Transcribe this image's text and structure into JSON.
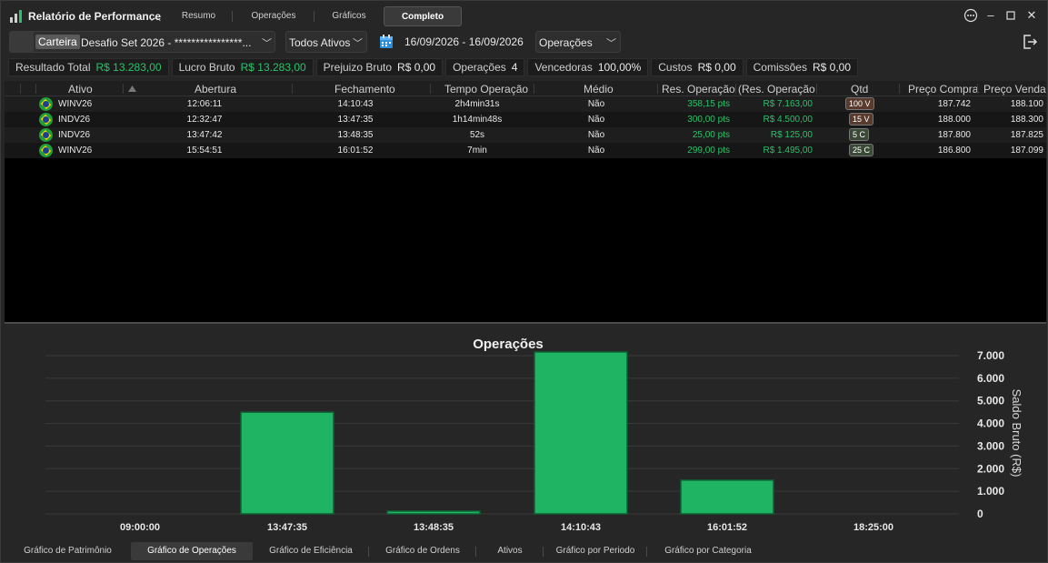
{
  "app": {
    "title": "Relatório de Performance"
  },
  "tabs": [
    {
      "label": "Resumo"
    },
    {
      "label": "Operações"
    },
    {
      "label": "Gráficos"
    },
    {
      "label": "Completo",
      "active": true
    }
  ],
  "filters": {
    "carteira_tag": "Carteira",
    "carteira_value": "Desafio Set 2026 - ****************...",
    "ativos": "Todos Ativos",
    "date_range": "16/09/2026 - 16/09/2026",
    "view": "Operações"
  },
  "stats": [
    {
      "label": "Resultado Total",
      "value": "R$ 13.283,00",
      "green": true
    },
    {
      "label": "Lucro Bruto",
      "value": "R$ 13.283,00",
      "green": true
    },
    {
      "label": "Prejuizo Bruto",
      "value": "R$ 0,00",
      "green": false
    },
    {
      "label": "Operações",
      "value": "4",
      "green": false
    },
    {
      "label": "Vencedoras",
      "value": "100,00%",
      "green": false
    },
    {
      "label": "Custos",
      "value": "R$ 0,00",
      "green": false
    },
    {
      "label": "Comissões",
      "value": "R$ 0,00",
      "green": false
    }
  ],
  "table": {
    "headers": [
      "Ativo",
      "Abertura",
      "Fechamento",
      "Tempo Operação",
      "Médio",
      "Res. Operação (",
      "Res. Operação",
      "Qtd",
      "Preço Compra",
      "Preço Venda"
    ],
    "rows": [
      {
        "ativo": "WINV26",
        "abertura": "12:06:11",
        "fechamento": "14:10:43",
        "tempo": "2h4min31s",
        "medio": "Não",
        "res_pts": "358,15 pts",
        "res_brl": "R$ 7.163,00",
        "qtd": "100 V",
        "qtd_side": "v",
        "compra": "187.742",
        "venda": "188.100"
      },
      {
        "ativo": "INDV26",
        "abertura": "12:32:47",
        "fechamento": "13:47:35",
        "tempo": "1h14min48s",
        "medio": "Não",
        "res_pts": "300,00 pts",
        "res_brl": "R$ 4.500,00",
        "qtd": "15 V",
        "qtd_side": "v",
        "compra": "188.000",
        "venda": "188.300"
      },
      {
        "ativo": "INDV26",
        "abertura": "13:47:42",
        "fechamento": "13:48:35",
        "tempo": "52s",
        "medio": "Não",
        "res_pts": "25,00 pts",
        "res_brl": "R$ 125,00",
        "qtd": "5 C",
        "qtd_side": "c",
        "compra": "187.800",
        "venda": "187.825"
      },
      {
        "ativo": "WINV26",
        "abertura": "15:54:51",
        "fechamento": "16:01:52",
        "tempo": "7min",
        "medio": "Não",
        "res_pts": "299,00 pts",
        "res_brl": "R$ 1.495,00",
        "qtd": "25 C",
        "qtd_side": "c",
        "compra": "186.800",
        "venda": "187.099"
      }
    ]
  },
  "chart_data": {
    "type": "bar",
    "title": "Operações",
    "ylabel": "Saldo Bruto (R$)",
    "xlabel": "",
    "x_ticks": [
      "09:00:00",
      "13:47:35",
      "13:48:35",
      "14:10:43",
      "16:01:52",
      "18:25:00"
    ],
    "categories": [
      "13:47:35",
      "13:48:35",
      "14:10:43",
      "16:01:52"
    ],
    "values": [
      4500,
      125,
      7163,
      1495
    ],
    "ylim": [
      0,
      7000
    ],
    "y_ticks": [
      "0",
      "1.000",
      "2.000",
      "3.000",
      "4.000",
      "5.000",
      "6.000",
      "7.000"
    ],
    "bar_color": "#1fb463",
    "grid": true,
    "legend": "none"
  },
  "bottom_tabs": [
    {
      "label": "Gráfico de Patrimônio"
    },
    {
      "label": "Gráfico de Operações",
      "active": true
    },
    {
      "label": "Gráfico de Eficiência"
    },
    {
      "label": "Gráfico de Ordens"
    },
    {
      "label": "Ativos"
    },
    {
      "label": "Gráfico por Periodo"
    },
    {
      "label": "Gráfico por Categoria"
    }
  ]
}
